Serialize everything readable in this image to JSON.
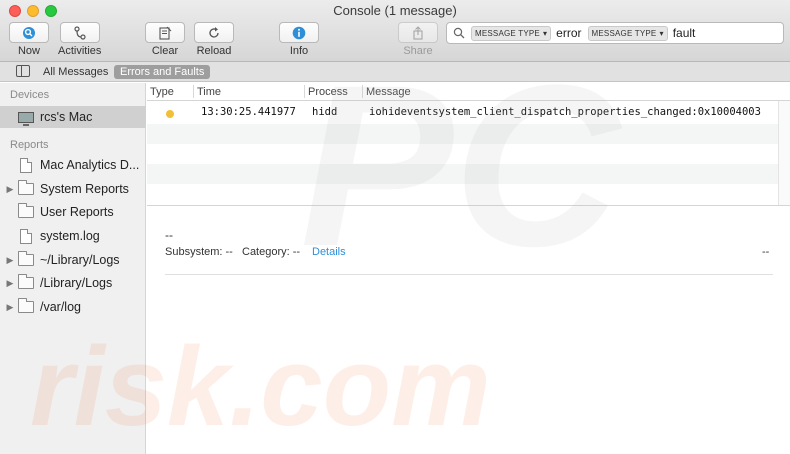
{
  "window": {
    "title": "Console (1 message)"
  },
  "toolbar": {
    "now": "Now",
    "activities": "Activities",
    "clear": "Clear",
    "reload": "Reload",
    "info": "Info",
    "share": "Share"
  },
  "search": {
    "token1": "MESSAGE TYPE",
    "value1": "error",
    "token2": "MESSAGE TYPE",
    "value2": "fault"
  },
  "scope": {
    "all_messages": "All Messages",
    "errors_faults": "Errors and Faults"
  },
  "sidebar": {
    "devices_header": "Devices",
    "device": "rcs's Mac",
    "reports_header": "Reports",
    "items": [
      {
        "label": "Mac Analytics D..."
      },
      {
        "label": "System Reports"
      },
      {
        "label": "User Reports"
      },
      {
        "label": "system.log"
      },
      {
        "label": "~/Library/Logs"
      },
      {
        "label": "/Library/Logs"
      },
      {
        "label": "/var/log"
      }
    ]
  },
  "table": {
    "columns": [
      "Type",
      "Time",
      "Process",
      "Message"
    ],
    "rows": [
      {
        "type_color": "#f2c037",
        "time": "13:30:25.441977",
        "process": "hidd",
        "message": "iohideventsystem_client_dispatch_properties_changed:0x10004003"
      }
    ]
  },
  "detail": {
    "dash": "--",
    "subsystem": "Subsystem: --",
    "category": "Category: --",
    "details_link": "Details",
    "right_dash": "--"
  },
  "watermark": {
    "top": "PC",
    "bottom": "risk.com"
  },
  "colors": {
    "accent": "#2e8fd8",
    "warning": "#f2c037",
    "selected_scope": "#9e9e9e"
  }
}
